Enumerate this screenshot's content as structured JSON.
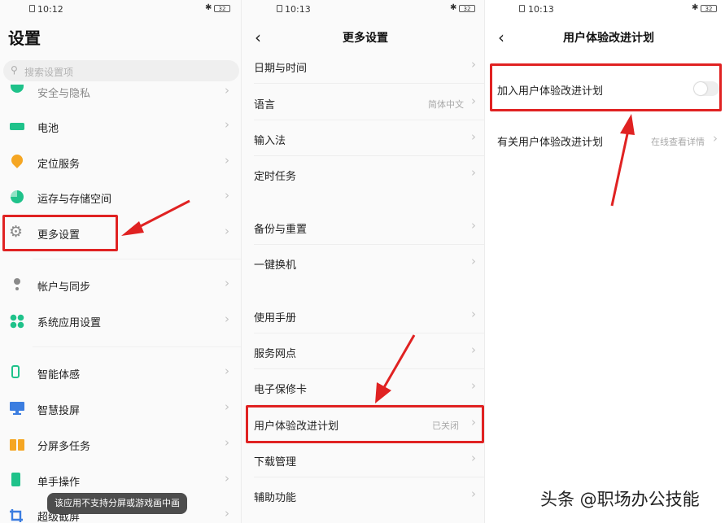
{
  "panel1": {
    "status": {
      "time": "10:12",
      "battery": "32"
    },
    "title": "设置",
    "search_placeholder": "搜索设置项",
    "items": [
      {
        "label": "安全与隐私",
        "icon": "security-icon"
      },
      {
        "label": "电池",
        "icon": "battery-icon"
      },
      {
        "label": "定位服务",
        "icon": "location-icon"
      },
      {
        "label": "运存与存储空间",
        "icon": "storage-icon"
      },
      {
        "label": "更多设置",
        "icon": "gear-icon"
      },
      {
        "label": "帐户与同步",
        "icon": "account-sync-icon"
      },
      {
        "label": "系统应用设置",
        "icon": "apps-icon"
      },
      {
        "label": "智能体感",
        "icon": "phone-gesture-icon"
      },
      {
        "label": "智慧投屏",
        "icon": "screen-cast-icon"
      },
      {
        "label": "分屏多任务",
        "icon": "split-screen-icon"
      },
      {
        "label": "单手操作",
        "icon": "one-hand-icon"
      },
      {
        "label": "超级截屏",
        "icon": "screenshot-icon"
      }
    ],
    "toast": "该应用不支持分屏或游戏画中画"
  },
  "panel2": {
    "status": {
      "time": "10:13",
      "battery": "32"
    },
    "title": "更多设置",
    "items": [
      {
        "label": "日期与时间",
        "value": ""
      },
      {
        "label": "语言",
        "value": "简体中文"
      },
      {
        "label": "输入法",
        "value": ""
      },
      {
        "label": "定时任务",
        "value": ""
      },
      {
        "label": "备份与重置",
        "value": ""
      },
      {
        "label": "一键换机",
        "value": ""
      },
      {
        "label": "使用手册",
        "value": ""
      },
      {
        "label": "服务网点",
        "value": ""
      },
      {
        "label": "电子保修卡",
        "value": ""
      },
      {
        "label": "用户体验改进计划",
        "value": "已关闭"
      },
      {
        "label": "下载管理",
        "value": ""
      },
      {
        "label": "辅助功能",
        "value": ""
      }
    ]
  },
  "panel3": {
    "status": {
      "time": "10:13",
      "battery": "32"
    },
    "title": "用户体验改进计划",
    "toggle_row": {
      "label": "加入用户体验改进计划",
      "enabled": false
    },
    "link_row": {
      "label": "有关用户体验改进计划",
      "value": "在线查看详情"
    }
  },
  "colors": {
    "highlight": "#e02222",
    "toggle_off": "#eeeeee"
  },
  "watermark": "头条 @职场办公技能"
}
